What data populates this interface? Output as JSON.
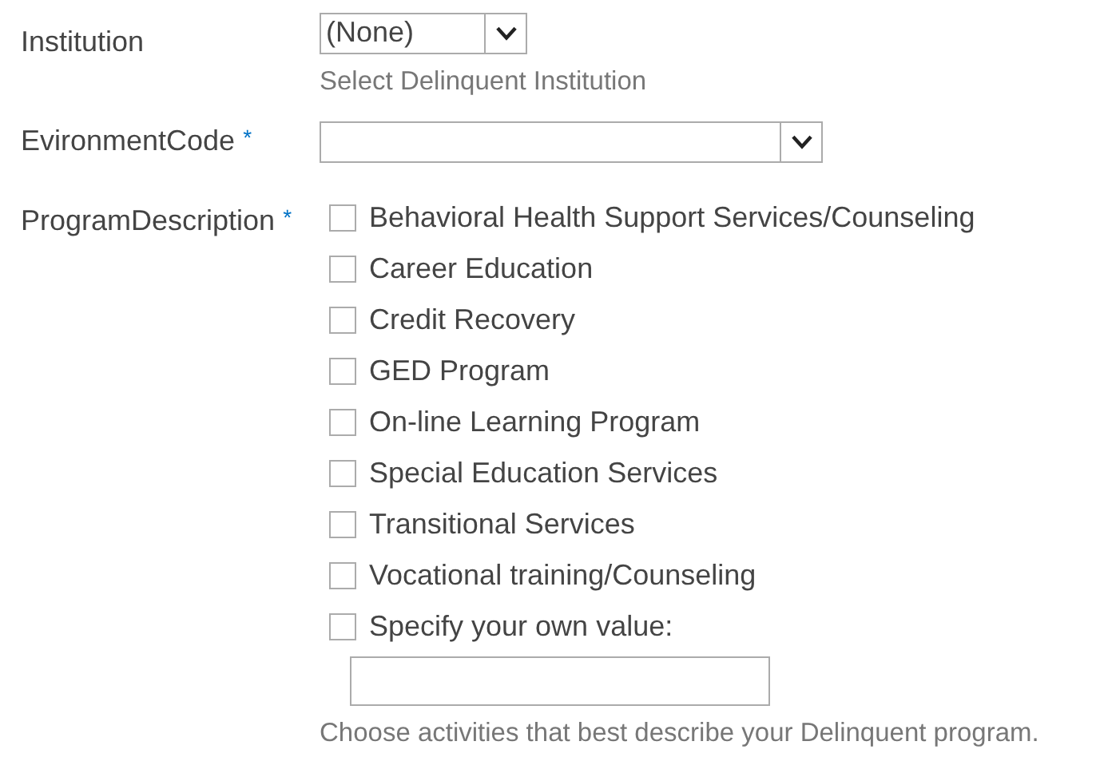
{
  "fields": [
    {
      "kind": "dropdown",
      "label": "Institution",
      "value": "(None)",
      "hint": "Select Delinquent Institution"
    },
    {
      "kind": "combo",
      "label": "EvironmentCode",
      "required_mark": "*"
    },
    {
      "kind": "checklist",
      "label": "ProgramDescription",
      "required_mark": "*",
      "options": [
        {
          "label": "Behavioral Health Support Services/Counseling",
          "checked": false
        },
        {
          "label": "Career Education",
          "checked": false
        },
        {
          "label": "Credit Recovery",
          "checked": false
        },
        {
          "label": "GED Program",
          "checked": false
        },
        {
          "label": "On-line Learning Program",
          "checked": false
        },
        {
          "label": "Special Education Services",
          "checked": false
        },
        {
          "label": "Transitional Services",
          "checked": false
        },
        {
          "label": "Vocational training/Counseling",
          "checked": false
        },
        {
          "label": "Specify your own value:",
          "checked": false
        }
      ],
      "hint": "Choose activities that best describe your Delinquent program."
    }
  ]
}
